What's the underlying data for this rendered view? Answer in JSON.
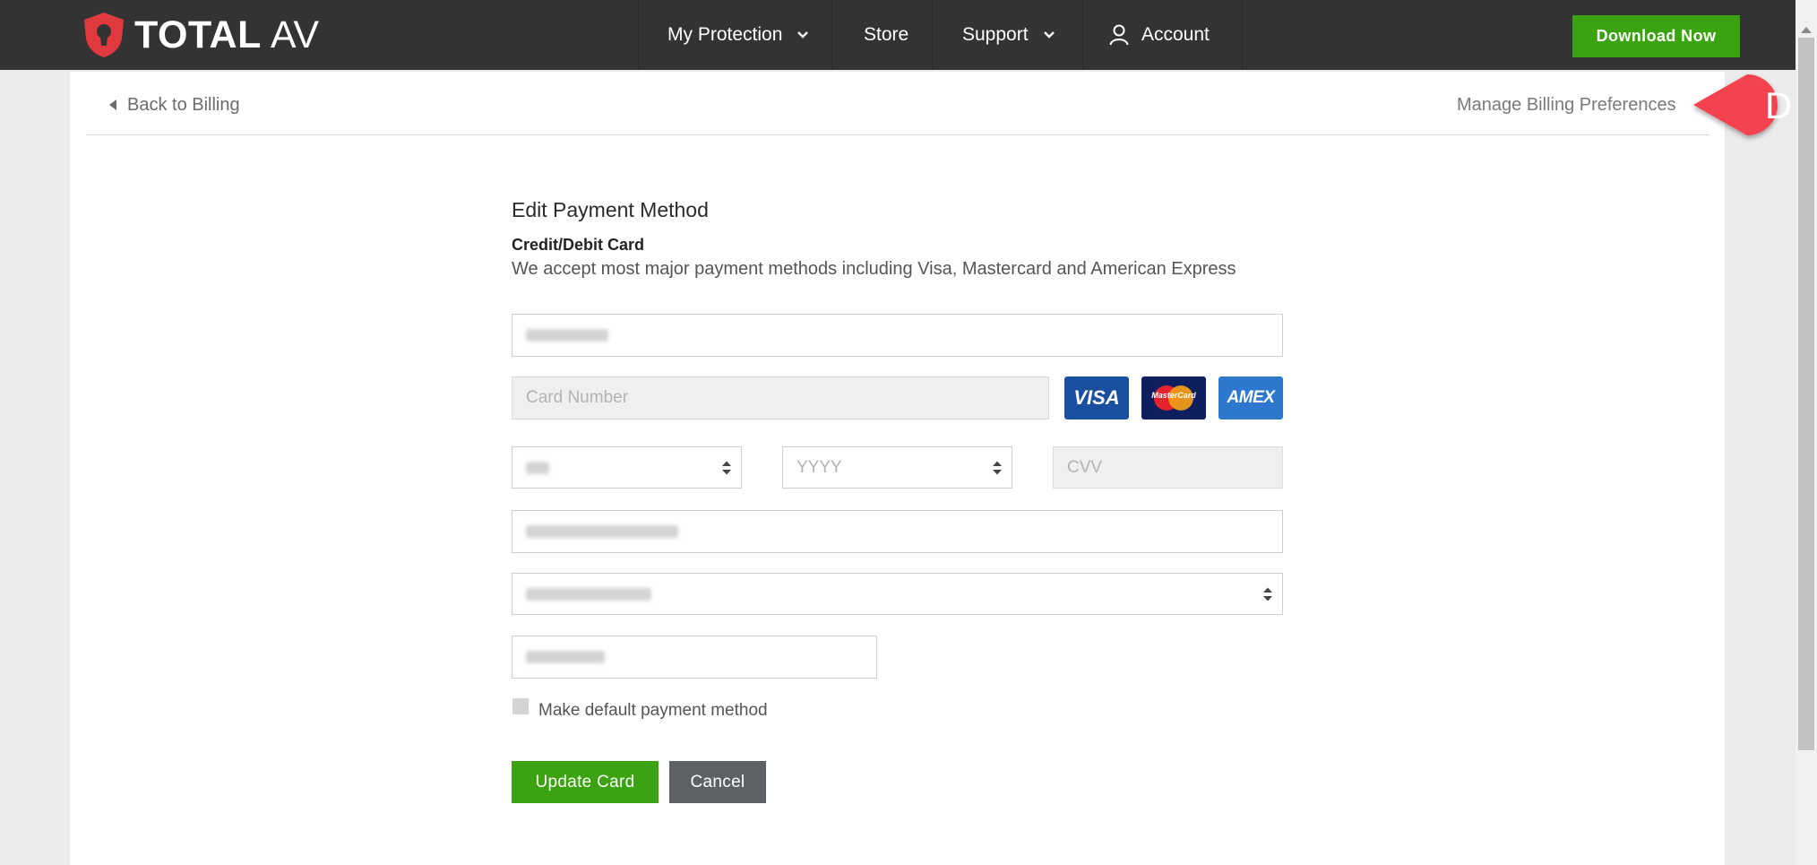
{
  "header": {
    "brand_bold": "TOTAL",
    "brand_light": "AV",
    "nav": [
      {
        "label": "My Protection",
        "has_dropdown": true
      },
      {
        "label": "Store",
        "has_dropdown": false
      },
      {
        "label": "Support",
        "has_dropdown": true
      },
      {
        "label": "Account",
        "icon": "user-icon"
      }
    ],
    "download_label": "Download Now"
  },
  "page": {
    "back_label": "Back to Billing",
    "manage_label": "Manage Billing Preferences",
    "callout_letter": "D"
  },
  "form": {
    "title": "Edit Payment Method",
    "subtitle": "Credit/Debit Card",
    "description": "We accept most major payment methods including Visa, Mastercard and American Express",
    "card_number_placeholder": "Card Number",
    "year_placeholder": "YYYY",
    "cvv_placeholder": "CVV",
    "card_logos": [
      "VISA",
      "MasterCard",
      "AMEX"
    ],
    "default_label": "Make default payment method",
    "default_checked": false,
    "update_label": "Update Card",
    "cancel_label": "Cancel"
  },
  "colors": {
    "topbar": "#333333",
    "accent_green": "#3aa30f",
    "cancel_gray": "#5d6166",
    "callout_red": "#f4434f",
    "brand_red": "#e0393e"
  }
}
